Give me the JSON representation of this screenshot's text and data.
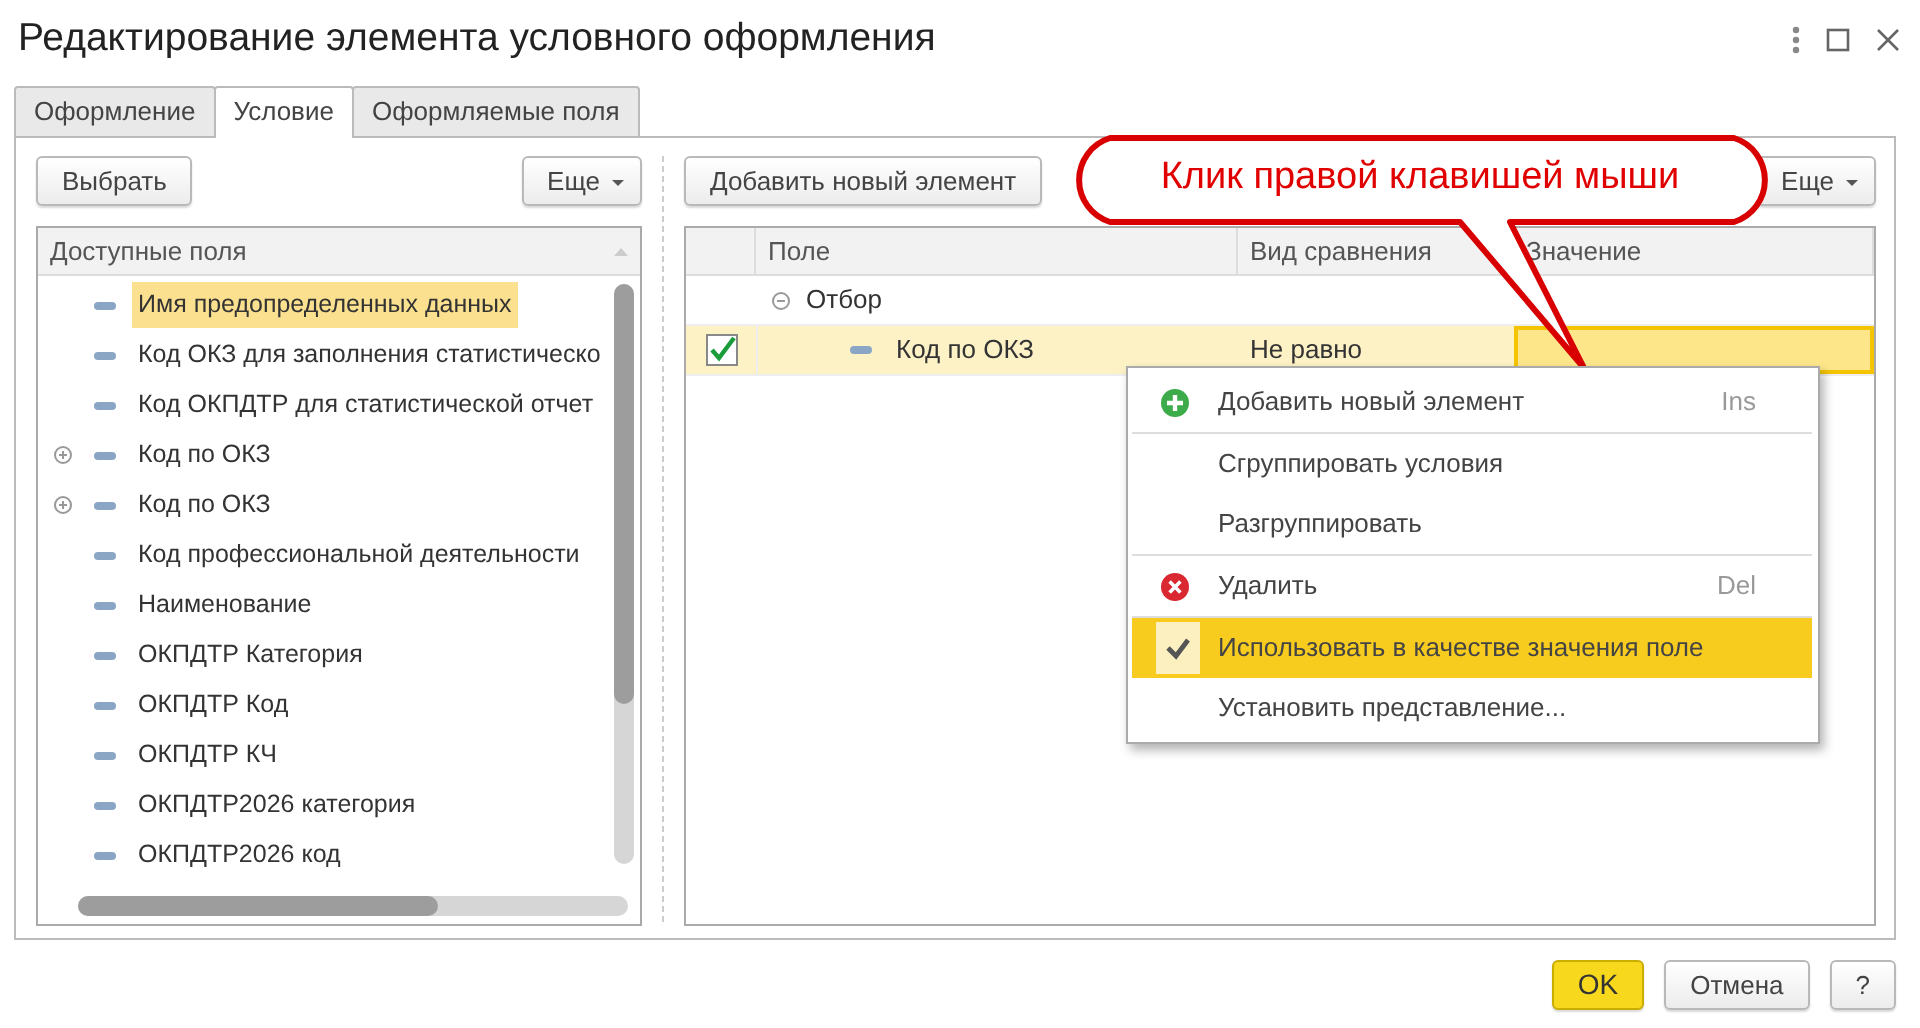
{
  "window": {
    "title": "Редактирование элемента условного оформления"
  },
  "tabs": [
    {
      "label": "Оформление",
      "selected": false
    },
    {
      "label": "Условие",
      "selected": true
    },
    {
      "label": "Оформляемые поля",
      "selected": false
    }
  ],
  "left_panel": {
    "buttons": [
      {
        "label": "Выбрать",
        "kind": "plain"
      },
      {
        "label": "Еще",
        "kind": "menu"
      }
    ],
    "header": "Доступные поля",
    "fields": [
      {
        "label": "Имя предопределенных данных",
        "expandable": false,
        "selected": true
      },
      {
        "label": "Код ОКЗ для заполнения статистическо",
        "expandable": false,
        "selected": false
      },
      {
        "label": "Код ОКПДТР для статистической отчет",
        "expandable": false,
        "selected": false
      },
      {
        "label": "Код по ОКЗ",
        "expandable": true,
        "selected": false
      },
      {
        "label": "Код по ОКЗ",
        "expandable": true,
        "selected": false
      },
      {
        "label": "Код профессиональной деятельности",
        "expandable": false,
        "selected": false
      },
      {
        "label": "Наименование",
        "expandable": false,
        "selected": false
      },
      {
        "label": "ОКПДТР Категория",
        "expandable": false,
        "selected": false
      },
      {
        "label": "ОКПДТР Код",
        "expandable": false,
        "selected": false
      },
      {
        "label": "ОКПДТР КЧ",
        "expandable": false,
        "selected": false
      },
      {
        "label": "ОКПДТР2026 категория",
        "expandable": false,
        "selected": false
      },
      {
        "label": "ОКПДТР2026 код",
        "expandable": false,
        "selected": false
      }
    ]
  },
  "right_panel": {
    "buttons": [
      {
        "label": "Добавить новый элемент",
        "kind": "plain"
      },
      {
        "label": "Еще",
        "kind": "menu"
      }
    ],
    "columns": [
      "Поле",
      "Вид сравнения",
      "Значение"
    ],
    "group": {
      "label": "Отбор",
      "expanded": true,
      "children": [
        {
          "field": "Код по ОКЗ",
          "comparison": "Не равно",
          "checked": true,
          "selected": true
        }
      ]
    }
  },
  "callout": {
    "text": "Клик правой клавишей мыши"
  },
  "context_menu": [
    {
      "kind": "add",
      "label": "Добавить новый элемент",
      "shortcut": "Ins",
      "separator_before": false,
      "selected": false
    },
    {
      "kind": "plain",
      "label": "Сгруппировать условия",
      "separator_before": true,
      "selected": false
    },
    {
      "kind": "plain",
      "label": "Разгруппировать",
      "separator_before": false,
      "selected": false
    },
    {
      "kind": "delete",
      "label": "Удалить",
      "shortcut": "Del",
      "separator_before": true,
      "selected": false
    },
    {
      "kind": "toggle",
      "label": "Использовать в качестве значения поле",
      "checked": true,
      "separator_before": true,
      "selected": true
    },
    {
      "kind": "plain",
      "label": "Установить представление...",
      "separator_before": false,
      "selected": false
    }
  ],
  "footer_buttons": [
    {
      "label": "OK",
      "kind": "default"
    },
    {
      "label": "Отмена",
      "kind": "plain"
    },
    {
      "label": "?",
      "kind": "plain"
    }
  ]
}
